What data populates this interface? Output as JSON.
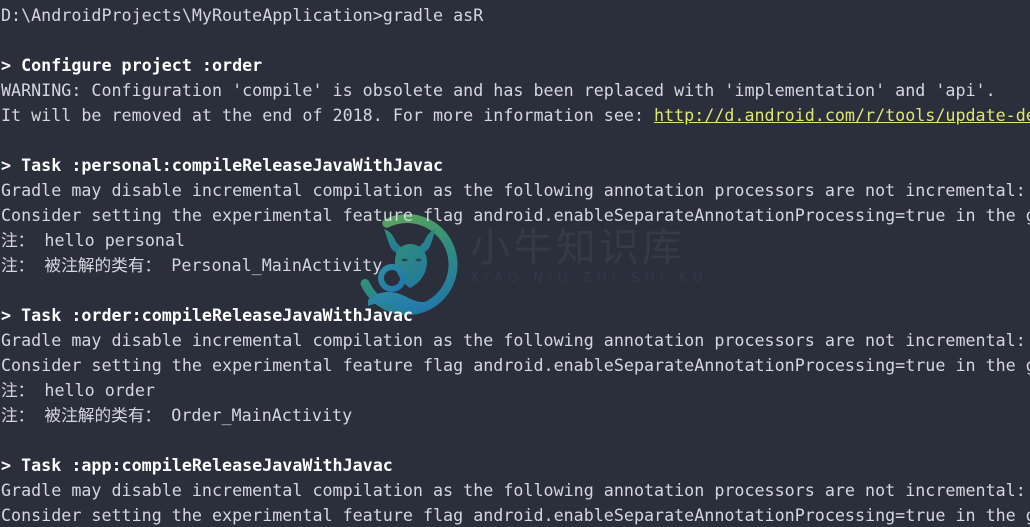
{
  "terminal": {
    "background_color": "#2b2e3b",
    "text_color": "#d3d7de",
    "heading_color": "#ffffff",
    "link_color": "#dfe773",
    "lines": [
      {
        "id": "prompt-command",
        "kind": "plain",
        "text": "D:\\AndroidProjects\\MyRouteApplication>gradle asR"
      },
      {
        "id": "blank-1",
        "kind": "blank",
        "text": ""
      },
      {
        "id": "configure-order-header",
        "kind": "heading",
        "text": "> Configure project :order"
      },
      {
        "id": "warning-compile-obsolete",
        "kind": "plain",
        "text": "WARNING: Configuration 'compile' is obsolete and has been replaced with 'implementation' and 'api'."
      },
      {
        "id": "warning-removal-notice",
        "kind": "link-line",
        "prefix": "It will be removed at the end of 2018. For more information see: ",
        "link": "http://d.android.com/r/tools/update-dependency-configurations"
      },
      {
        "id": "blank-2",
        "kind": "blank",
        "text": ""
      },
      {
        "id": "task-personal-header",
        "kind": "heading",
        "text": "> Task :personal:compileReleaseJavaWithJavac"
      },
      {
        "id": "personal-gradle-incremental",
        "kind": "plain",
        "text": "Gradle may disable incremental compilation as the following annotation processors are not incremental:"
      },
      {
        "id": "personal-consider-flag",
        "kind": "plain",
        "text": "Consider setting the experimental feature flag android.enableSeparateAnnotationProcessing=true in the gradle.properties"
      },
      {
        "id": "personal-note-hello",
        "kind": "plain",
        "text": "注： hello personal"
      },
      {
        "id": "personal-note-annotated",
        "kind": "plain",
        "text": "注： 被注解的类有： Personal_MainActivity"
      },
      {
        "id": "blank-3",
        "kind": "blank",
        "text": ""
      },
      {
        "id": "task-order-header",
        "kind": "heading",
        "text": "> Task :order:compileReleaseJavaWithJavac"
      },
      {
        "id": "order-gradle-incremental",
        "kind": "plain",
        "text": "Gradle may disable incremental compilation as the following annotation processors are not incremental:"
      },
      {
        "id": "order-consider-flag",
        "kind": "plain",
        "text": "Consider setting the experimental feature flag android.enableSeparateAnnotationProcessing=true in the gradle.properties"
      },
      {
        "id": "order-note-hello",
        "kind": "plain",
        "text": "注： hello order"
      },
      {
        "id": "order-note-annotated",
        "kind": "plain",
        "text": "注： 被注解的类有： Order_MainActivity"
      },
      {
        "id": "blank-4",
        "kind": "blank",
        "text": ""
      },
      {
        "id": "task-app-header",
        "kind": "heading",
        "text": "> Task :app:compileReleaseJavaWithJavac"
      },
      {
        "id": "app-gradle-incremental",
        "kind": "plain",
        "text": "Gradle may disable incremental compilation as the following annotation processors are not incremental:"
      },
      {
        "id": "app-consider-flag",
        "kind": "plain",
        "text": "Consider setting the experimental feature flag android.enableSeparateAnnotationProcessing=true in the gradle.properties"
      }
    ]
  },
  "watermark": {
    "chinese_text": "小牛知识库",
    "pinyin_text": "XIAO NIU ZHI SHI KU",
    "logo_name": "bull-in-hand-circle-logo",
    "ring_color_start": "#4c9a5b",
    "ring_color_end": "#2a7fa4",
    "text_color": "#353a47"
  }
}
